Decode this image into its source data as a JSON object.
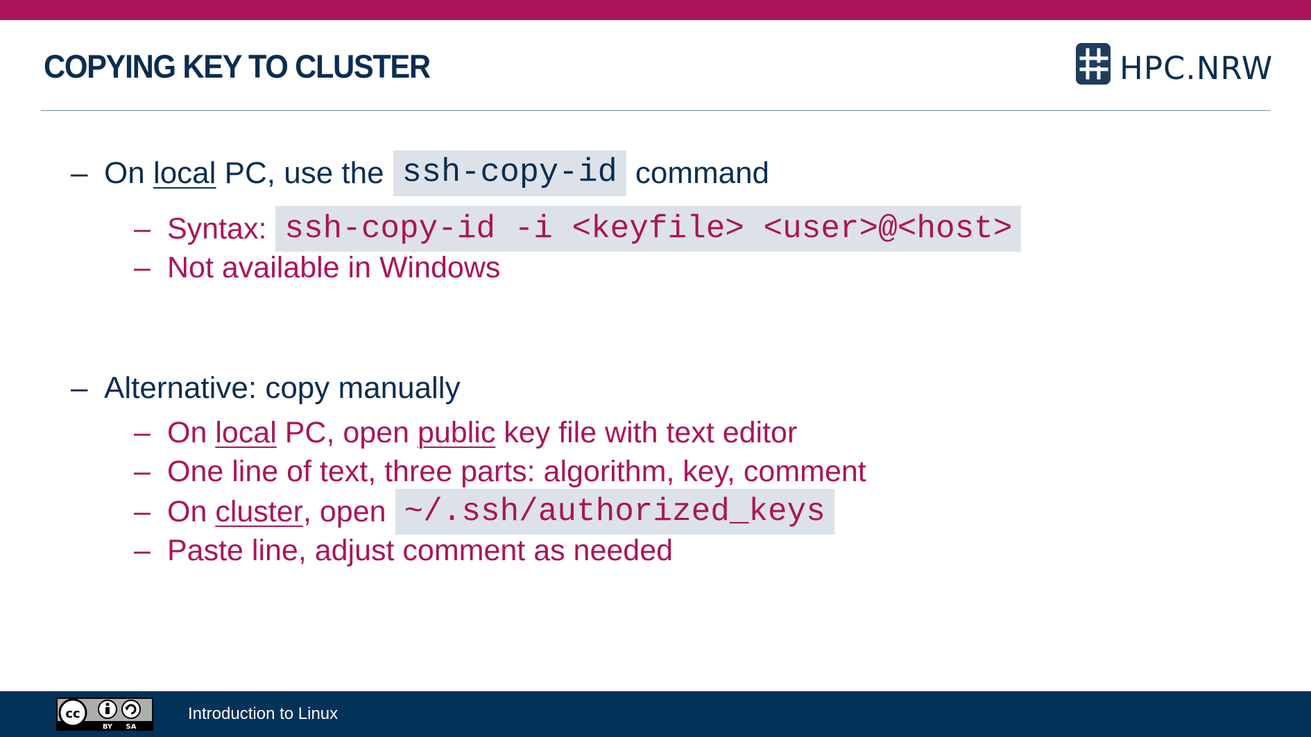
{
  "slide": {
    "title": "COPYING KEY TO CLUSTER"
  },
  "logo": {
    "text": "HPC.NRW",
    "icon": "hashtag-logo-icon"
  },
  "bullets": {
    "dash": "–",
    "b1": {
      "pre": "On",
      "local": "local",
      "mid": "PC, use the",
      "code": "ssh-copy-id",
      "post": "command"
    },
    "b1_1": {
      "pre": "Syntax:",
      "code": "ssh-copy-id -i <keyfile> <user>@<host>"
    },
    "b1_2": {
      "text": "Not available in Windows"
    },
    "b2": {
      "text": "Alternative: copy manually"
    },
    "b2_1": {
      "pre": "On",
      "local": "local",
      "mid": "PC, open",
      "public": "public",
      "post": "key file with text editor"
    },
    "b2_2": {
      "text": "One line of text, three parts: algorithm, key, comment"
    },
    "b2_3": {
      "pre": "On",
      "cluster": "cluster",
      "mid": ", open",
      "code": "~/.ssh/authorized_keys"
    },
    "b2_4": {
      "text": "Paste line, adjust comment as needed"
    }
  },
  "footer": {
    "text": "Introduction to Linux",
    "license": {
      "icon": "cc-by-sa-icon",
      "by": "BY",
      "sa": "SA"
    }
  },
  "colors": {
    "accent": "#ab1459",
    "navy": "#0b2d52",
    "footer_bg": "#00325a",
    "code_bg": "#dde2e9"
  }
}
